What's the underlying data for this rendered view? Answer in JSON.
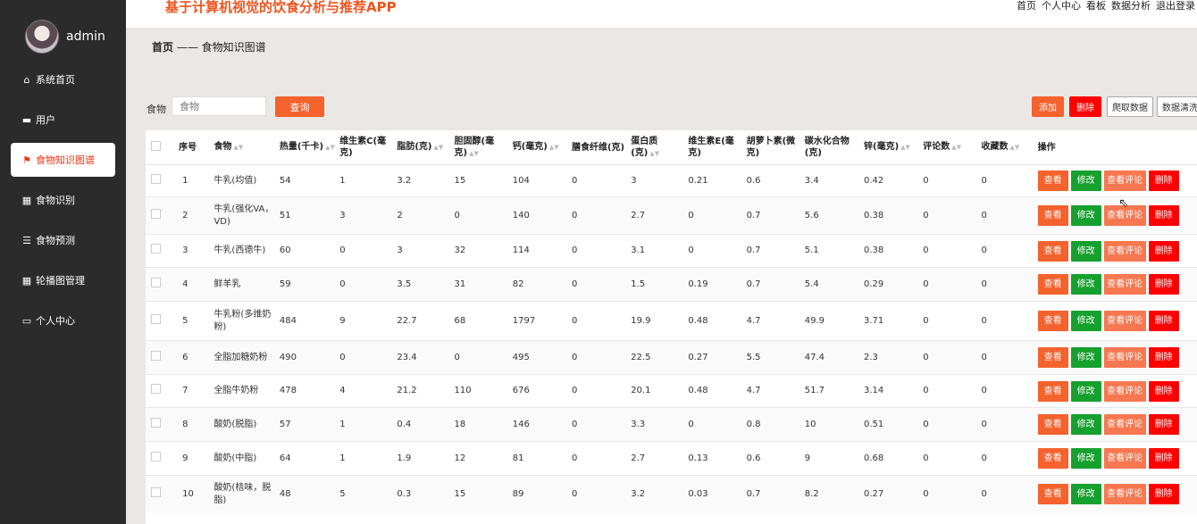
{
  "header": {
    "app_title": "基于计算机视觉的饮食分析与推荐APP",
    "nav": [
      "首页",
      "个人中心",
      "看板",
      "数据分析",
      "退出登录"
    ]
  },
  "sidebar": {
    "username": "admin",
    "items": [
      {
        "label": "系统首页",
        "icon": "home-icon",
        "active": false
      },
      {
        "label": "用户",
        "icon": "briefcase-icon",
        "active": false
      },
      {
        "label": "食物知识图谱",
        "icon": "flag-icon",
        "active": true
      },
      {
        "label": "食物识别",
        "icon": "grid-icon",
        "active": false
      },
      {
        "label": "食物预测",
        "icon": "list-icon",
        "active": false
      },
      {
        "label": "轮播图管理",
        "icon": "grid-icon",
        "active": false
      },
      {
        "label": "个人中心",
        "icon": "card-icon",
        "active": false
      }
    ]
  },
  "breadcrumb": {
    "home": "首页",
    "separator": "——",
    "current": "食物知识图谱"
  },
  "search": {
    "label": "食物",
    "placeholder": "食物",
    "button": "查询"
  },
  "toolbar": {
    "add": "添加",
    "delete": "删除",
    "crawl": "爬取数据",
    "clean": "数据清洗"
  },
  "table": {
    "columns": [
      {
        "label": "",
        "sortable": false
      },
      {
        "label": "序号",
        "sortable": false
      },
      {
        "label": "食物",
        "sortable": true
      },
      {
        "label": "热量(千卡)",
        "sortable": true
      },
      {
        "label": "维生素C(毫克)",
        "sortable": false
      },
      {
        "label": "脂肪(克)",
        "sortable": true
      },
      {
        "label": "胆固醇(毫克)",
        "sortable": true
      },
      {
        "label": "钙(毫克)",
        "sortable": true
      },
      {
        "label": "膳食纤维(克)",
        "sortable": false
      },
      {
        "label": "蛋白质(克)",
        "sortable": true
      },
      {
        "label": "维生素E(毫克)",
        "sortable": false
      },
      {
        "label": "胡萝卜素(微克)",
        "sortable": false
      },
      {
        "label": "碳水化合物(克)",
        "sortable": false
      },
      {
        "label": "锌(毫克)",
        "sortable": true
      },
      {
        "label": "评论数",
        "sortable": true
      },
      {
        "label": "收藏数",
        "sortable": true
      },
      {
        "label": "操作",
        "sortable": false
      }
    ],
    "actions": [
      "查看",
      "修改",
      "查看评论",
      "删除"
    ],
    "rows": [
      [
        "1",
        "牛乳(均值)",
        "54",
        "1",
        "3.2",
        "15",
        "104",
        "0",
        "3",
        "0.21",
        "0.6",
        "3.4",
        "0.42",
        "0",
        "0"
      ],
      [
        "2",
        "牛乳(强化VA，VD)",
        "51",
        "3",
        "2",
        "0",
        "140",
        "0",
        "2.7",
        "0",
        "0.7",
        "5.6",
        "0.38",
        "0",
        "0"
      ],
      [
        "3",
        "牛乳(西德牛)",
        "60",
        "0",
        "3",
        "32",
        "114",
        "0",
        "3.1",
        "0",
        "0.7",
        "5.1",
        "0.38",
        "0",
        "0"
      ],
      [
        "4",
        "鲜羊乳",
        "59",
        "0",
        "3.5",
        "31",
        "82",
        "0",
        "1.5",
        "0.19",
        "0.7",
        "5.4",
        "0.29",
        "0",
        "0"
      ],
      [
        "5",
        "牛乳粉(多维奶粉)",
        "484",
        "9",
        "22.7",
        "68",
        "1797",
        "0",
        "19.9",
        "0.48",
        "4.7",
        "49.9",
        "3.71",
        "0",
        "0"
      ],
      [
        "6",
        "全脂加糖奶粉",
        "490",
        "0",
        "23.4",
        "0",
        "495",
        "0",
        "22.5",
        "0.27",
        "5.5",
        "47.4",
        "2.3",
        "0",
        "0"
      ],
      [
        "7",
        "全脂牛奶粉",
        "478",
        "4",
        "21.2",
        "110",
        "676",
        "0",
        "20.1",
        "0.48",
        "4.7",
        "51.7",
        "3.14",
        "0",
        "0"
      ],
      [
        "8",
        "酸奶(脱脂)",
        "57",
        "1",
        "0.4",
        "18",
        "146",
        "0",
        "3.3",
        "0",
        "0.8",
        "10",
        "0.51",
        "0",
        "0"
      ],
      [
        "9",
        "酸奶(中脂)",
        "64",
        "1",
        "1.9",
        "12",
        "81",
        "0",
        "2.7",
        "0.13",
        "0.6",
        "9",
        "0.68",
        "0",
        "0"
      ],
      [
        "10",
        "酸奶(桔味，脱脂)",
        "48",
        "5",
        "0.3",
        "15",
        "89",
        "0",
        "3.2",
        "0.03",
        "0.7",
        "8.2",
        "0.27",
        "0",
        "0"
      ]
    ]
  }
}
